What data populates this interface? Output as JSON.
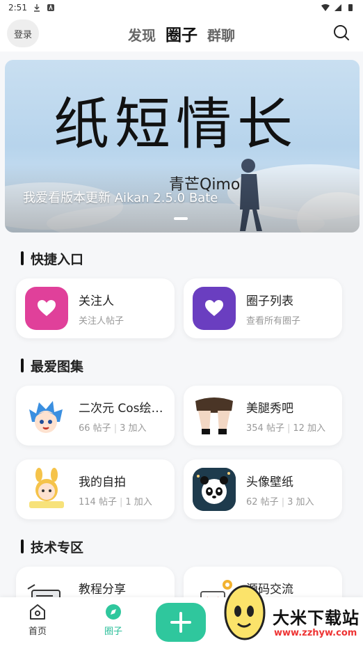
{
  "status_bar": {
    "time": "2:51"
  },
  "header": {
    "login_label": "登录",
    "tabs": [
      {
        "label": "发现",
        "active": false
      },
      {
        "label": "圈子",
        "active": true
      },
      {
        "label": "群聊",
        "active": false
      }
    ]
  },
  "banner": {
    "artwork_text": "纸短情长",
    "artwork_subtitle": "青芒Qimo",
    "title": "我爱看版本更新 Aikan 2.5.0 Bate"
  },
  "sections": {
    "quick": {
      "title": "快捷入口",
      "items": [
        {
          "title": "关注人",
          "sub": "关注人帖子",
          "icon": "heart-icon",
          "color": "#e0409a"
        },
        {
          "title": "圈子列表",
          "sub": "查看所有圈子",
          "icon": "heart-icon",
          "color": "#6a3ec0"
        }
      ]
    },
    "favorites": {
      "title": "最爱图集",
      "items": [
        {
          "title": "二次元 Cos绘…",
          "posts": "66 帖子",
          "joins": "3 加入",
          "icon": "anime-girl-avatar"
        },
        {
          "title": "美腿秀吧",
          "posts": "354 帖子",
          "joins": "12 加入",
          "icon": "legs-avatar"
        },
        {
          "title": "我的自拍",
          "posts": "114 帖子",
          "joins": "1 加入",
          "icon": "bunny-girl-avatar"
        },
        {
          "title": "头像壁纸",
          "posts": "62 帖子",
          "joins": "3 加入",
          "icon": "panda-avatar"
        }
      ]
    },
    "tech": {
      "title": "技术专区",
      "items": [
        {
          "title": "教程分享",
          "icon": "tutorial-icon"
        },
        {
          "title": "源码交流",
          "icon": "code-icon"
        }
      ]
    }
  },
  "bottom_nav": {
    "home_label": "首页",
    "circle_label": "圈子",
    "accent": "#2fc79d"
  },
  "watermark": {
    "name": "大米下载站",
    "url": "www.zzhyw.com"
  }
}
